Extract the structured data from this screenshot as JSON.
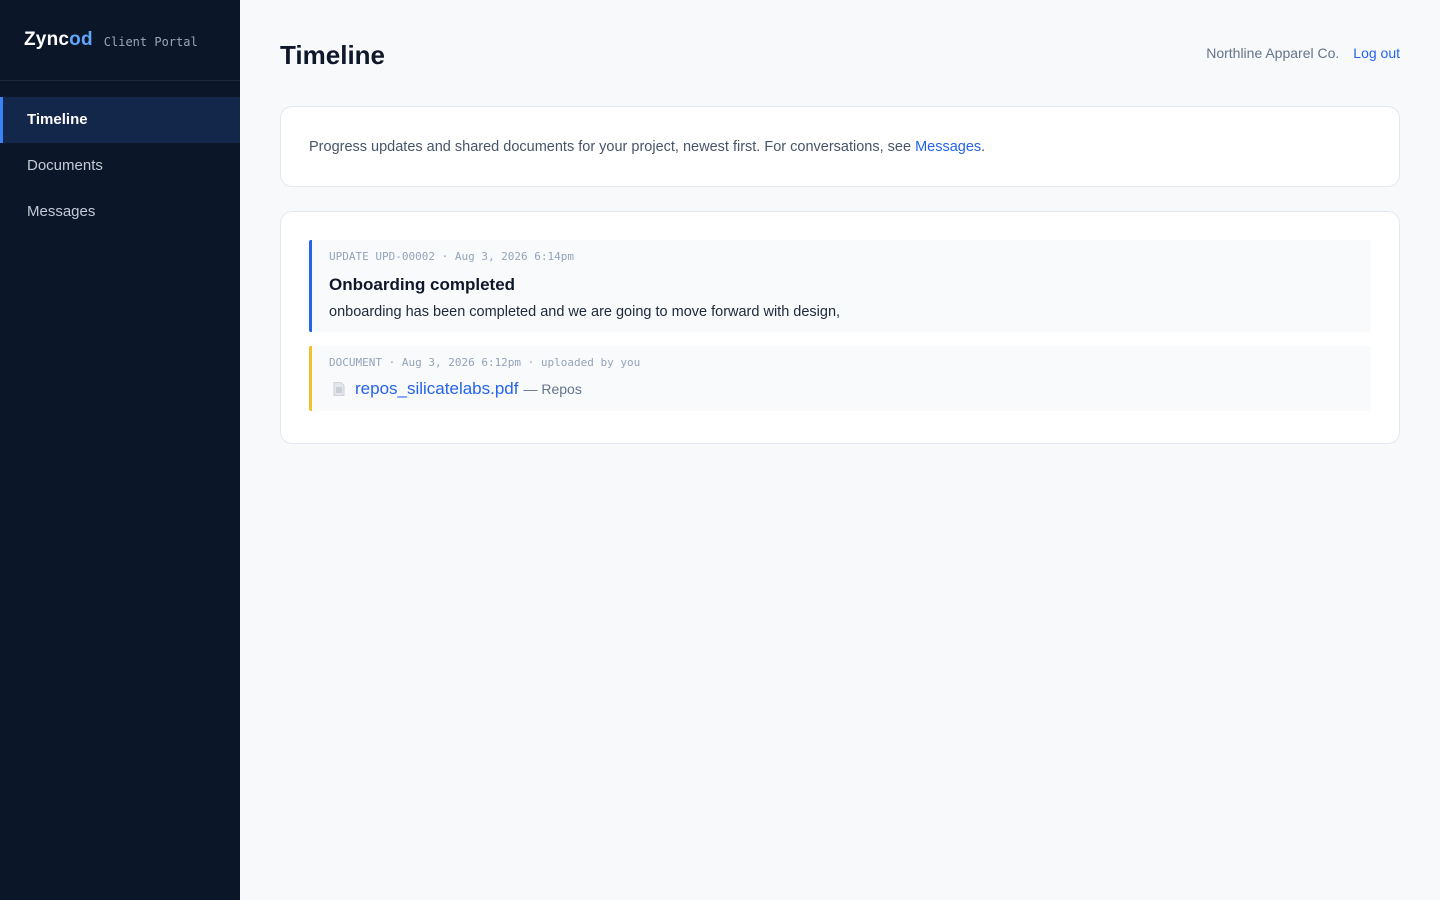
{
  "brand": {
    "name_main": "Zync",
    "name_accent": "od",
    "subtitle": "Client Portal"
  },
  "nav": {
    "items": [
      {
        "label": "Timeline"
      },
      {
        "label": "Documents"
      },
      {
        "label": "Messages"
      }
    ],
    "active": "Timeline"
  },
  "header": {
    "title": "Timeline",
    "client_name": "Northline Apparel Co.",
    "logout_label": "Log out"
  },
  "intro": {
    "text": "Progress updates and shared documents for your project, newest first. For conversations, see ",
    "link_label": "Messages",
    "suffix": "."
  },
  "feed": {
    "update": {
      "meta": "UPDATE UPD-00002 · Aug 3, 2026 6:14pm",
      "title": "Onboarding completed",
      "body": "onboarding has been completed and we are going to move forward with design,"
    },
    "document": {
      "meta": "DOCUMENT · Aug 3, 2026 6:12pm · uploaded by you",
      "icon": "file-icon",
      "filename": "repos_silicatelabs.pdf",
      "folder": "— Repos"
    }
  },
  "colors": {
    "sidebar": "#0b1628",
    "accent": "#2563eb",
    "update_bar": "#2563eb",
    "document_bar": "#f0c12c"
  }
}
